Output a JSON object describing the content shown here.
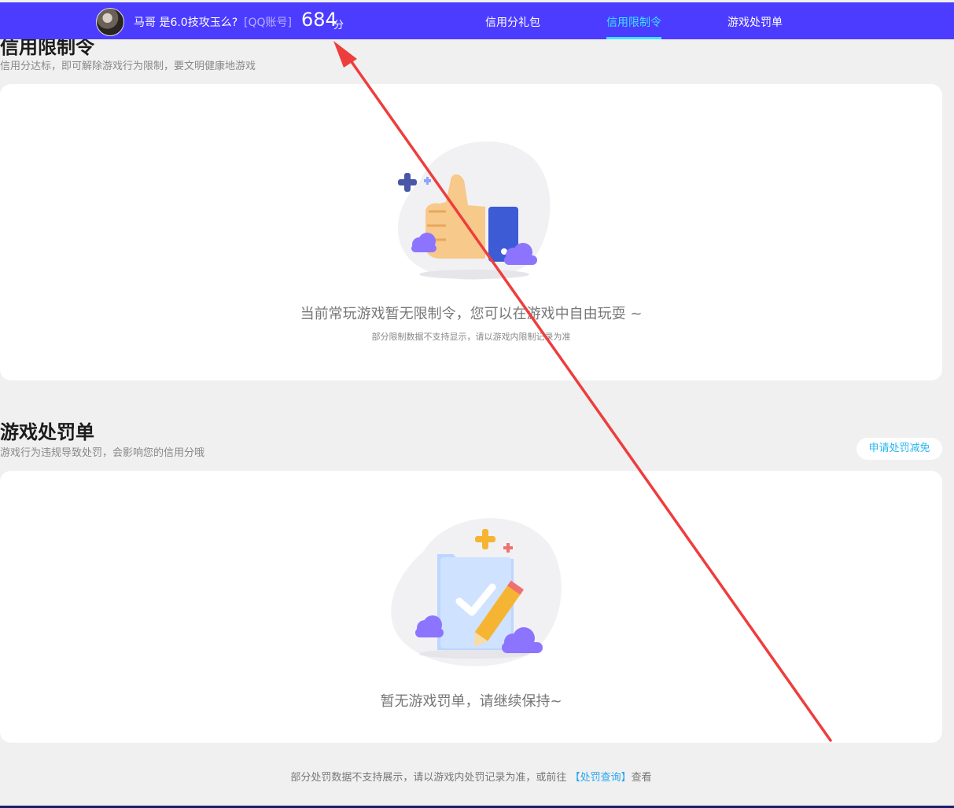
{
  "header": {
    "username": "马哥 是6.0技攻玉么?",
    "account_type": "[QQ账号]",
    "score": "684",
    "score_unit": "分",
    "nav": [
      "信用分礼包",
      "信用限制令",
      "游戏处罚单"
    ],
    "active_tab": "信用限制令",
    "colors": {
      "bar": "#4c3cff",
      "accent": "#39e6ff"
    }
  },
  "restriction": {
    "title": "信用限制令",
    "subtitle": "信用分达标，即可解除游戏行为限制，要文明健康地游戏",
    "empty_main": "当前常玩游戏暂无限制令，您可以在游戏中自由玩耍 ~",
    "empty_sub": "部分限制数据不支持显示，请以游戏内限制记录为准",
    "illustration_icon": "thumbs-up-illustration"
  },
  "penalty": {
    "title": "游戏处罚单",
    "subtitle": "游戏行为违规导致处罚，会影响您的信用分哦",
    "action_label": "申请处罚减免",
    "empty_main": "暂无游戏罚单，请继续保持~",
    "illustration_icon": "clipboard-check-illustration"
  },
  "footer": {
    "text_before": "部分处罚数据不支持展示，请以游戏内处罚记录为准，或前往",
    "link": "【处罚查询】",
    "text_after": "查看"
  }
}
